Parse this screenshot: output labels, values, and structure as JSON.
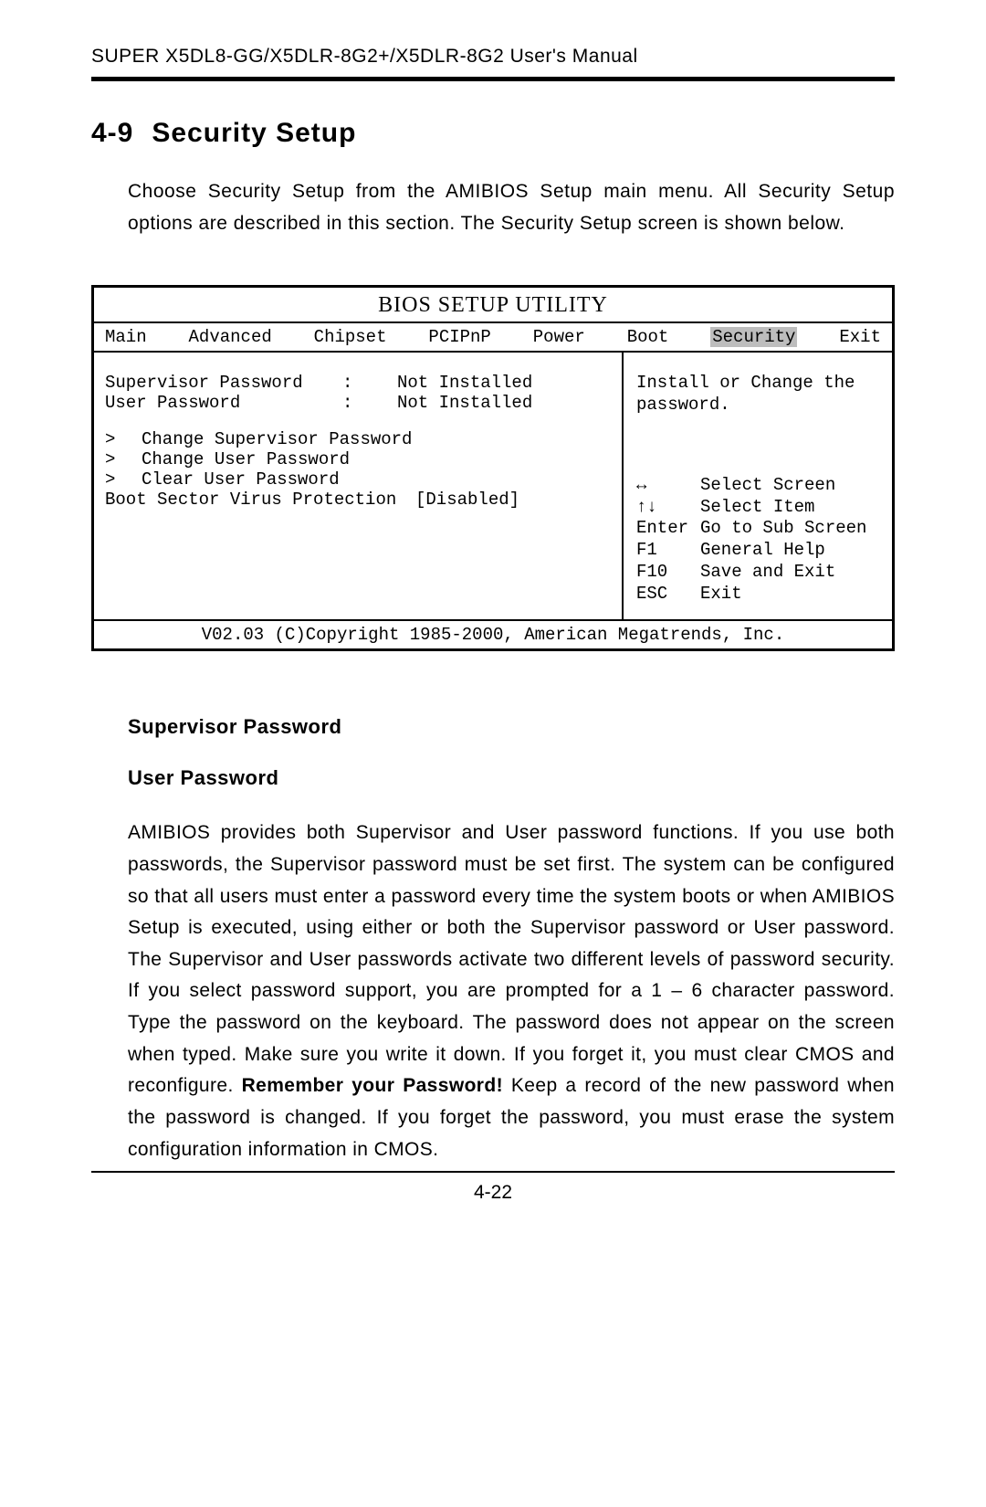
{
  "header": {
    "running_head": "SUPER X5DL8-GG/X5DLR-8G2+/X5DLR-8G2 User's Manual"
  },
  "section": {
    "number": "4-9",
    "title": "Security Setup",
    "intro": "Choose Security Setup from the AMIBIOS Setup main menu.  All Security Setup options are described in this section.  The Security Setup screen is shown below."
  },
  "bios": {
    "title": "BIOS SETUP UTILITY",
    "menu": [
      "Main",
      "Advanced",
      "Chipset",
      "PCIPnP",
      "Power",
      "Boot",
      "Security",
      "Exit"
    ],
    "selected_menu_index": 6,
    "status": [
      {
        "label": "Supervisor Password",
        "colon": ":",
        "value": "Not Installed"
      },
      {
        "label": "User Password",
        "colon": ":",
        "value": "Not Installed"
      }
    ],
    "actions": [
      {
        "caret": ">",
        "label": "Change Supervisor Password"
      },
      {
        "caret": ">",
        "label": "Change User Password"
      },
      {
        "caret": ">",
        "label": "Clear User Password"
      }
    ],
    "option": {
      "label": "Boot Sector Virus Protection",
      "value": "[Disabled]"
    },
    "help_top": "Install or Change the password.",
    "keys": [
      {
        "key": "↔",
        "desc": "Select Screen"
      },
      {
        "key": "↑↓",
        "desc": "Select Item"
      },
      {
        "key": "Enter",
        "desc": "Go to Sub Screen"
      },
      {
        "key": "F1",
        "desc": "General Help"
      },
      {
        "key": "F10",
        "desc": "Save and Exit"
      },
      {
        "key": "ESC",
        "desc": "Exit"
      }
    ],
    "copyright": "V02.03 (C)Copyright 1985-2000, American Megatrends, Inc."
  },
  "subsections": {
    "h1": "Supervisor Password",
    "h2": "User Password",
    "para_a": "AMIBIOS provides both Supervisor and User password functions. If you use both passwords, the Supervisor password must be set first. The system can be configured so that all users must enter a password every time the system boots or when AMIBIOS Setup is executed, using either or both the Supervisor password or User password. The Supervisor and User passwords activate two different levels of password security. If you select password support, you are prompted for a 1 – 6 character password. Type the password on the keyboard. The password does not appear on the screen when typed. Make sure you write it down. If you forget it, you must clear CMOS and reconfigure. ",
    "para_bold": "Remember your Password!",
    "para_b": "  Keep a record of the new password when the password is changed. If you forget the password, you must erase the system configuration information in CMOS."
  },
  "footer": {
    "page_number": "4-22"
  }
}
